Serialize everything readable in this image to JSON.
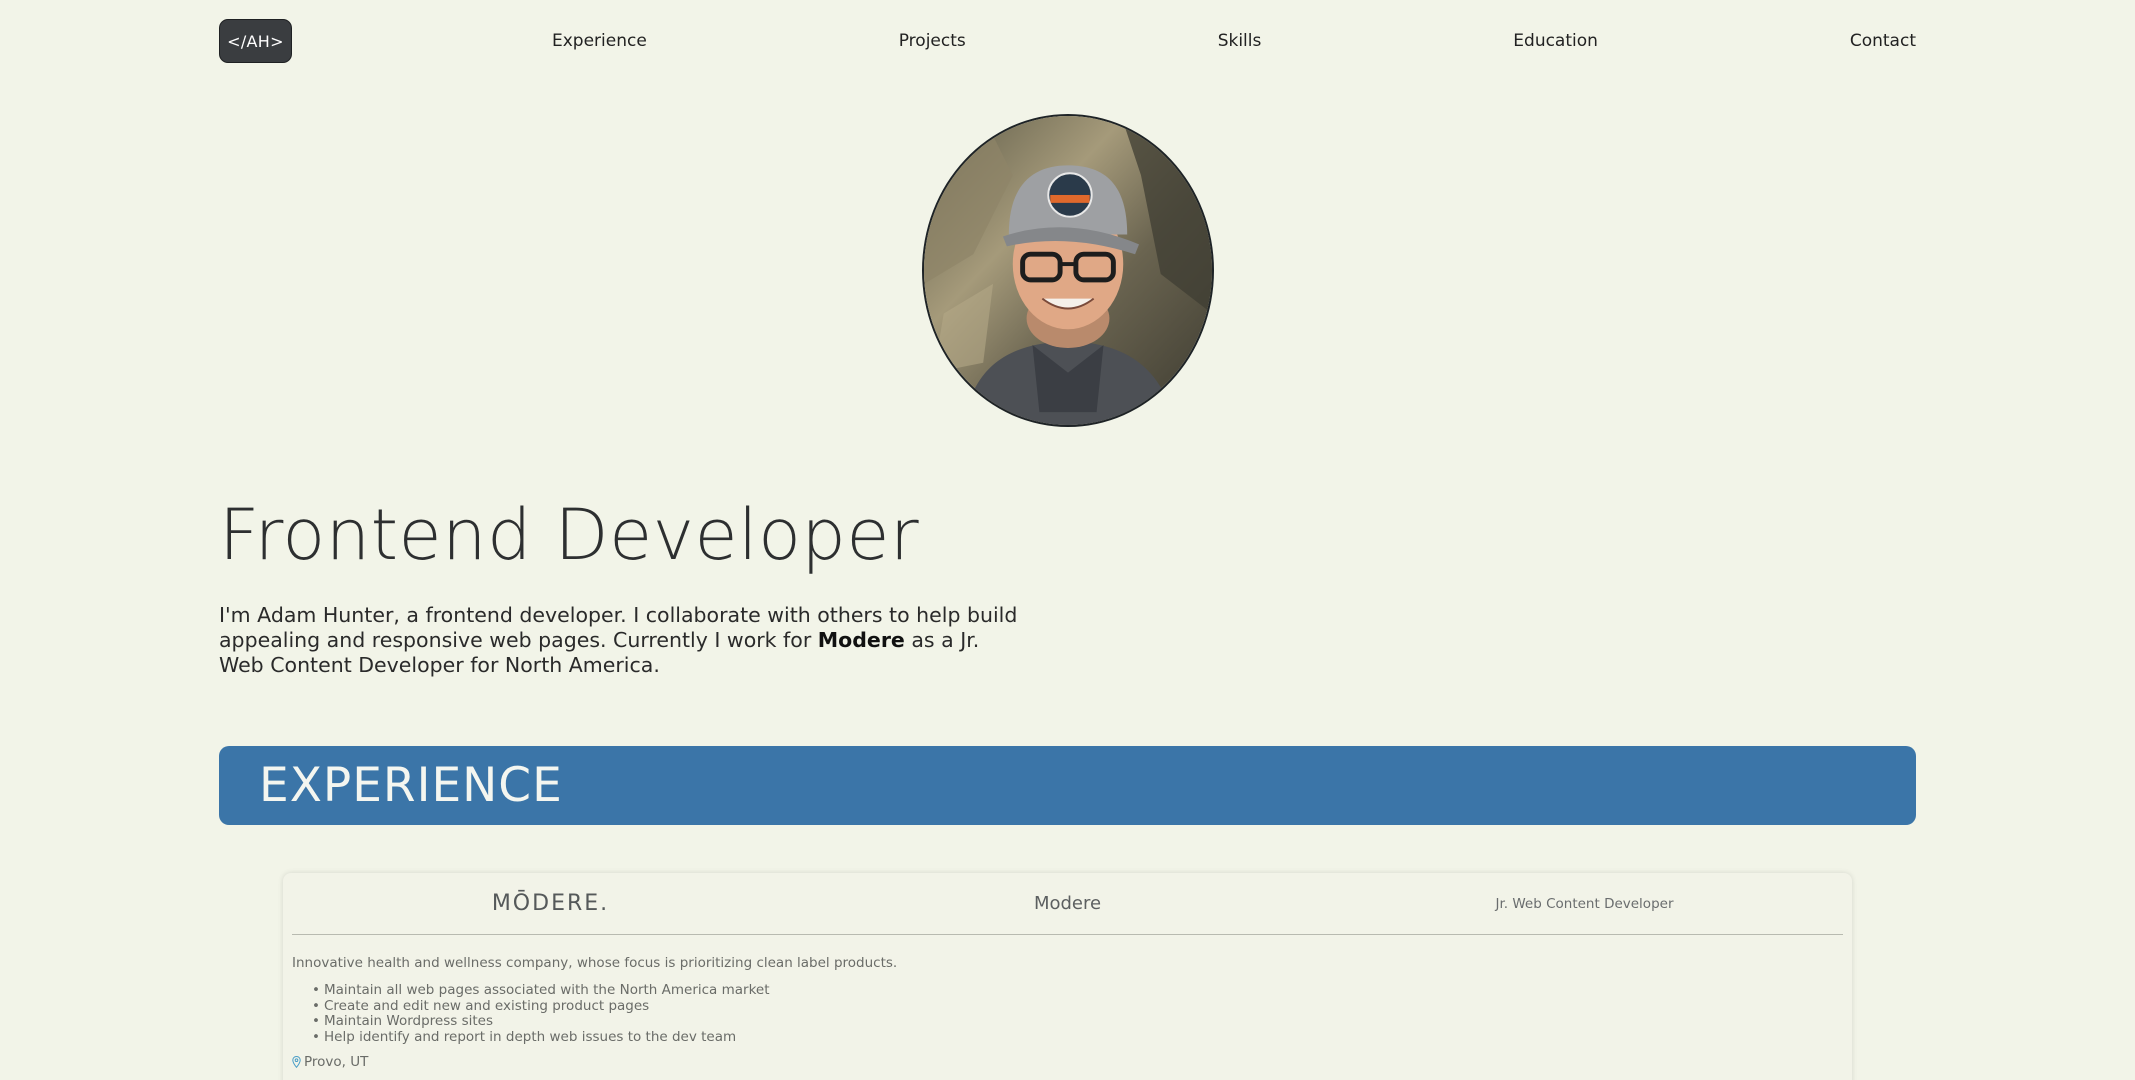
{
  "nav": {
    "logo": "</AH>",
    "links": [
      "Experience",
      "Projects",
      "Skills",
      "Education",
      "Contact"
    ]
  },
  "hero": {
    "title": "Frontend Developer",
    "intro_before": "I'm Adam Hunter, a frontend developer. I collaborate with others to help build appealing and responsive web pages. Currently I work for ",
    "intro_company": "Modere",
    "intro_after": " as a Jr. Web Content Developer for North America."
  },
  "experience": {
    "heading": "EXPERIENCE",
    "jobs": [
      {
        "logo_text": "MŌDERE.",
        "company": "Modere",
        "role": "Jr. Web Content Developer",
        "description": "Innovative health and wellness company, whose focus is prioritizing clean label products.",
        "bullets": [
          "Maintain all web pages associated with the North America market",
          "Create and edit new and existing product pages",
          "Maintain Wordpress sites",
          "Help identify and report in depth web issues to the dev team"
        ],
        "location": "Provo, UT"
      }
    ]
  },
  "colors": {
    "background": "#f2f4e8",
    "accent": "#3b75a8",
    "logo_bg": "#3a3d40"
  }
}
